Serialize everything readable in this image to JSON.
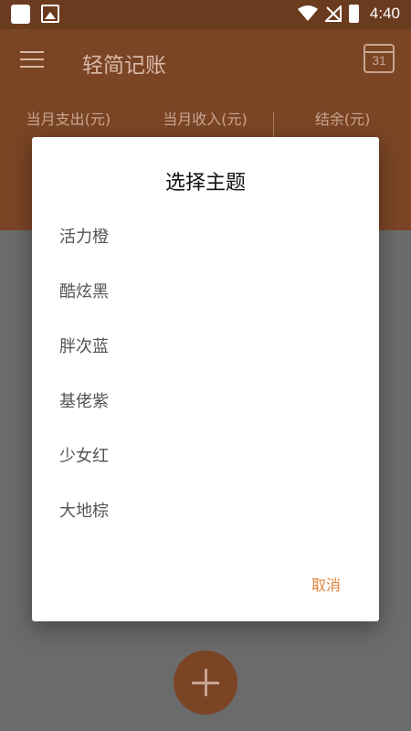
{
  "status_bar": {
    "time": "4:40",
    "icons": [
      "notification-square-icon",
      "image-icon",
      "wifi-icon",
      "no-signal-icon",
      "battery-charging-icon"
    ]
  },
  "toolbar": {
    "title": "轻简记账",
    "calendar_day": "31"
  },
  "summary": {
    "expense_label": "当月支出(元)",
    "income_label": "当月收入(元)",
    "balance_label": "结余(元)"
  },
  "dialog": {
    "title": "选择主题",
    "options": [
      "活力橙",
      "酷炫黑",
      "胖次蓝",
      "基佬紫",
      "少女红",
      "大地棕"
    ],
    "cancel_label": "取消"
  },
  "colors": {
    "primary_brown": "#7a4425",
    "accent_orange": "#e1843c"
  }
}
